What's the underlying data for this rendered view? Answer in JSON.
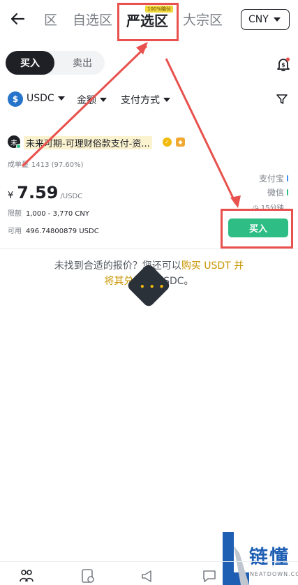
{
  "header": {
    "tabs": [
      {
        "label": "区",
        "active": false
      },
      {
        "label": "自选区",
        "active": false
      },
      {
        "label": "严选区",
        "active": true,
        "badge": "100%赔付"
      },
      {
        "label": "大宗区",
        "active": false
      }
    ],
    "currency": "CNY"
  },
  "side_toggle": {
    "buy": "买入",
    "sell": "卖出"
  },
  "filters": {
    "coin": "USDC",
    "coin_icon": "$",
    "amount": "金额",
    "payment": "支付方式"
  },
  "offer": {
    "avatar": "未",
    "merchant": "未来可期-可理财俗款支付-资...",
    "trades_label": "成单量",
    "trades_value": "1413 (97.60%)",
    "price_symbol": "¥",
    "price": "7.59",
    "price_unit": "/USDC",
    "limit_label": "限额",
    "limit_value": "1,000 - 3,770 CNY",
    "available_label": "可用",
    "available_value": "496.74800879 USDC",
    "payments": [
      {
        "name": "支付宝",
        "color": "#3b8ff0"
      },
      {
        "name": "微信",
        "color": "#2ebd85"
      }
    ],
    "timer": "15分钟",
    "buy_button": "买入"
  },
  "hint": {
    "line1": "未找到合适的报价？您还可以",
    "link1": "购买 USDT 并",
    "link2": "将其兑换",
    "line2": "为 USDC。"
  },
  "overlay": {
    "dots": "• • •"
  },
  "watermark": {
    "text": "链懂",
    "sub": "NEATDOWN.COM"
  },
  "colors": {
    "accent": "#f0b90b",
    "buy": "#2ebd85",
    "annotation": "#e8514d",
    "link": "#c99400"
  }
}
